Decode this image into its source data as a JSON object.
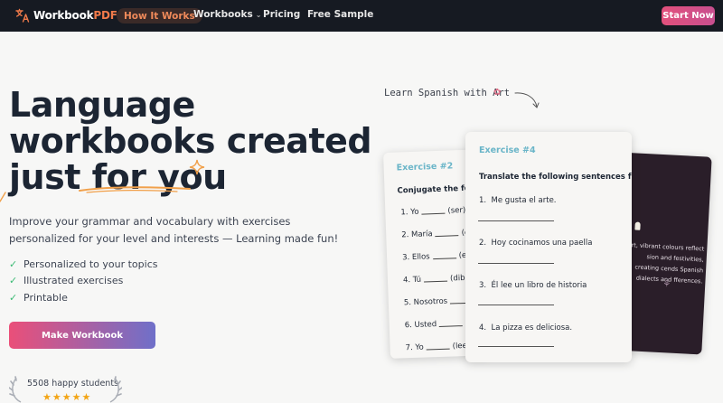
{
  "nav": {
    "logo_main": "Workbook",
    "logo_accent": "PDF",
    "items": [
      {
        "label": "How It Works"
      },
      {
        "label": "Workbooks"
      },
      {
        "label": "Pricing"
      },
      {
        "label": "Free Sample"
      }
    ],
    "cta": "Start Now",
    "icons": {
      "logo": "translate-icon",
      "workbooks_dropdown": "chevron-down-icon"
    }
  },
  "hero": {
    "title_line1": "Language",
    "title_line2": "workbooks created",
    "title_line3_a": "just ",
    "title_line3_b": "for you",
    "subtitle": "Improve your grammar and vocabulary with exercises personalized for your level and interests — Learning made fun!",
    "features": [
      "Personalized to your topics",
      "Illustrated exercises",
      "Printable"
    ],
    "cta": "Make Workbook",
    "students": "5508 happy students",
    "stars": "★★★★★",
    "rating_stars": 5
  },
  "showcase": {
    "note": "Learn Spanish with Art",
    "note_icon": "palette-icon",
    "card_left": {
      "tag": "Exercise #2",
      "instruction": "Conjugate the followi",
      "lines": [
        {
          "n": "1.",
          "a": "Yo",
          "b": "(ser) a"
        },
        {
          "n": "2.",
          "a": "María",
          "b": "(co"
        },
        {
          "n": "3.",
          "a": "Ellos",
          "b": "(es"
        },
        {
          "n": "4.",
          "a": "Tú",
          "b": "(dibu"
        },
        {
          "n": "5.",
          "a": "Nosotros",
          "b": "("
        },
        {
          "n": "6.",
          "a": "Usted",
          "b": "("
        },
        {
          "n": "7.",
          "a": "Yo",
          "b": "(lee"
        }
      ]
    },
    "card_main": {
      "tag": "Exercise #4",
      "instruction": "Translate the following sentences from Spanish",
      "items": [
        {
          "n": "1.",
          "text": "Me gusta el arte."
        },
        {
          "n": "2.",
          "text": "Hoy cocinamos una paella"
        },
        {
          "n": "3.",
          "text": "Él lee un libro de historia"
        },
        {
          "n": "4.",
          "text": "La pizza es deliciosa."
        }
      ]
    },
    "card_dark": {
      "text": "rt, vibrant colours reflect sion and festivities, creating cends Spanish dialects and fferences."
    }
  }
}
